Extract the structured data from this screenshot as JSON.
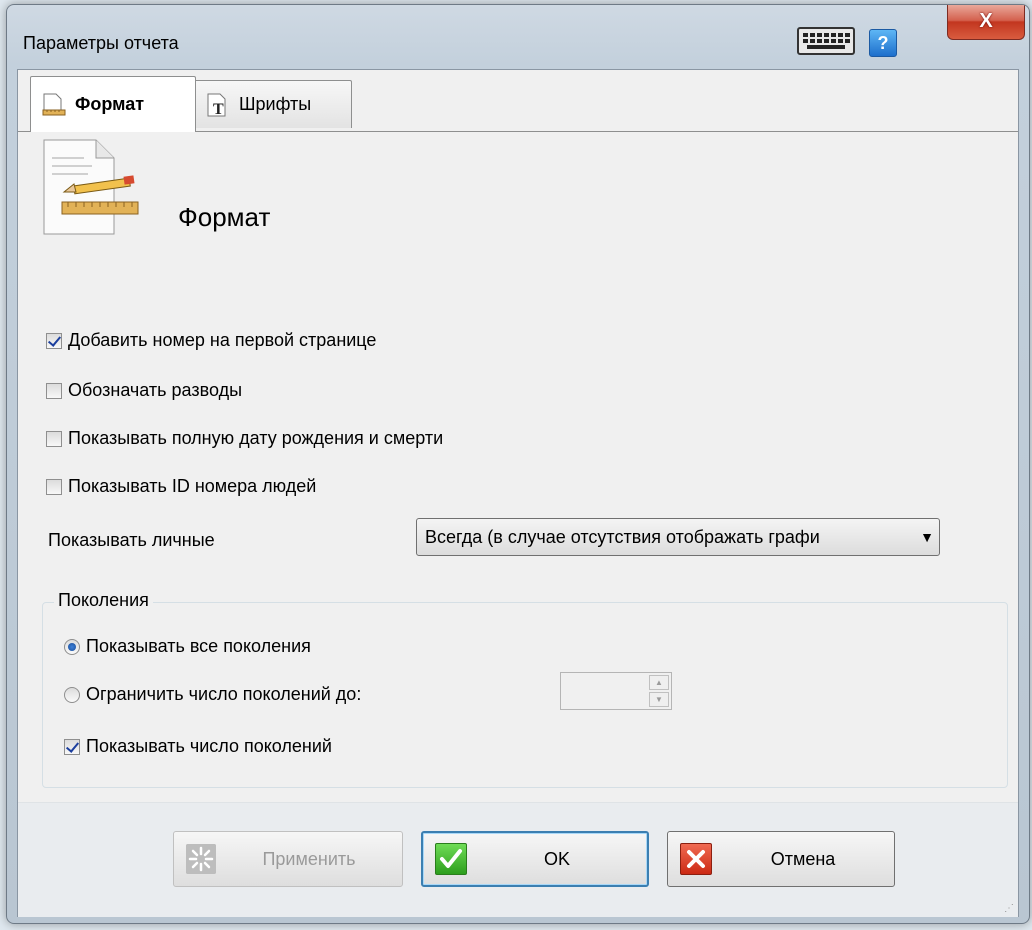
{
  "window": {
    "title": "Параметры отчета",
    "help_label": "?",
    "close_label": "X"
  },
  "tabs": [
    {
      "label": "Формат",
      "icon": "page-ruler-icon",
      "active": true
    },
    {
      "label": "Шрифты",
      "icon": "font-t-icon",
      "active": false
    }
  ],
  "section": {
    "title": "Формат",
    "icon": "document-pencil-ruler-icon"
  },
  "options": [
    {
      "label": "Добавить номер на первой странице",
      "checked": true
    },
    {
      "label": "Обозначать разводы",
      "checked": false
    },
    {
      "label": "Показывать полную дату рождения и смерти",
      "checked": false
    },
    {
      "label": "Показывать ID номера людей",
      "checked": false
    }
  ],
  "personal": {
    "label": "Показывать личные",
    "selected": "Всегда (в случае отсутствия отображать графи",
    "arrow": "▼"
  },
  "generations": {
    "legend": "Поколения",
    "radio_all": {
      "label": "Показывать все поколения",
      "checked": true
    },
    "radio_limit": {
      "label": "Ограничить число поколений до:",
      "checked": false
    },
    "limit_value": "",
    "spin_up": "▲",
    "spin_down": "▼",
    "show_count": {
      "label": "Показывать число поколений",
      "checked": true
    }
  },
  "buttons": {
    "apply": "Применить",
    "ok": "OK",
    "cancel": "Отмена"
  },
  "colors": {
    "accent": "#3c7fb1",
    "ok_green": "#2d9e1d",
    "cancel_red": "#cc2a14",
    "close_red": "#c2361f"
  }
}
